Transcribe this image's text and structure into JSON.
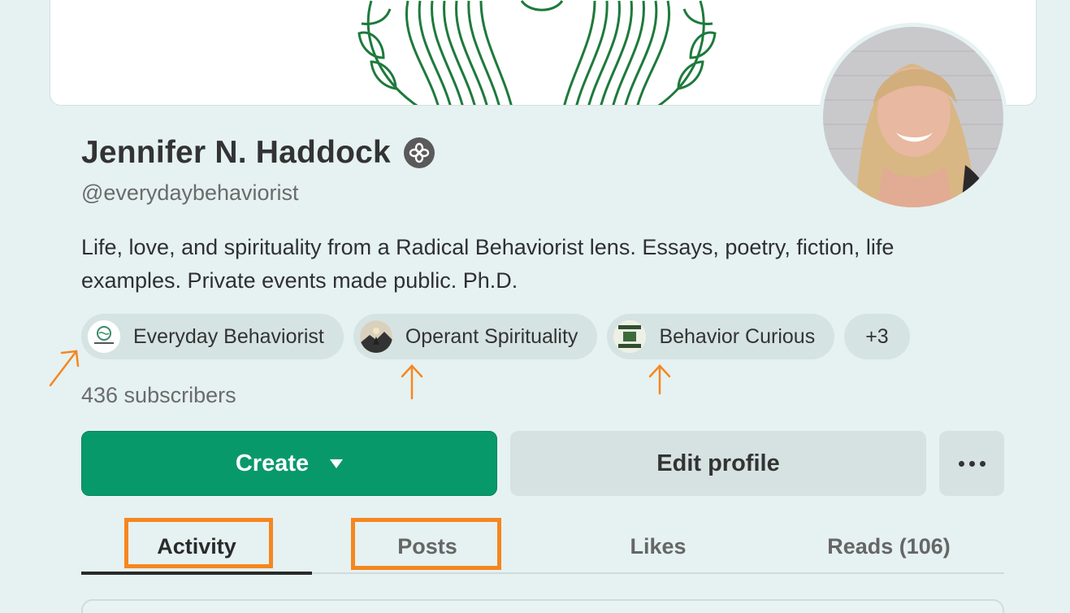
{
  "profile": {
    "name": "Jennifer N. Haddock",
    "handle": "@everydaybehaviorist",
    "bio": "Life, love, and spirituality from a Radical Behaviorist lens. Essays, poetry, fiction, life examples. Private events made public. Ph.D.",
    "subscribers": "436 subscribers"
  },
  "publications": [
    {
      "name": "Everyday Behaviorist",
      "icon": "everyday-behaviorist-logo"
    },
    {
      "name": "Operant Spirituality",
      "icon": "operant-spirituality-logo"
    },
    {
      "name": "Behavior Curious",
      "icon": "behavior-curious-logo"
    }
  ],
  "more_publications": "+3",
  "actions": {
    "create": "Create",
    "edit": "Edit profile"
  },
  "tabs": [
    {
      "label": "Activity",
      "active": true
    },
    {
      "label": "Posts"
    },
    {
      "label": "Likes"
    },
    {
      "label": "Reads (106)"
    }
  ],
  "colors": {
    "background": "#e5f2f1",
    "primary": "#08996a",
    "annotation": "#f6861f"
  }
}
